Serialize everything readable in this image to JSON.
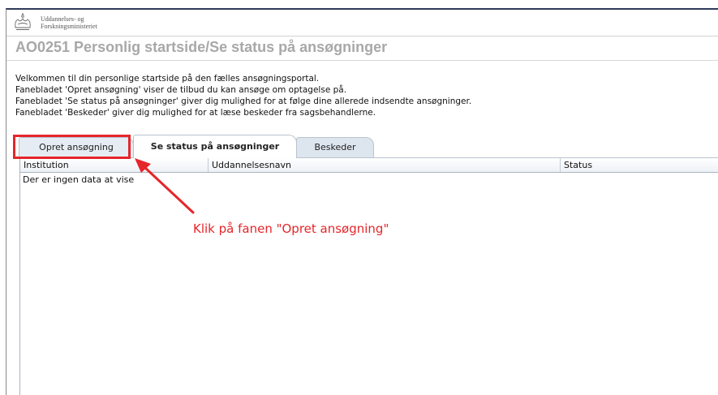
{
  "header": {
    "org_line1": "Uddannelses- og",
    "org_line2": "Forskningsministeriet",
    "title": "AO0251 Personlig startside/Se status på ansøgninger"
  },
  "intro": [
    "Velkommen til din personlige startside på den fælles ansøgningsportal.",
    "Fanebladet 'Opret ansøgning' viser de tilbud du kan ansøge om optagelse på.",
    "Fanebladet 'Se status på ansøgninger' giver dig mulighed for at følge dine allerede indsendte ansøgninger.",
    "Fanebladet 'Beskeder' giver dig mulighed for at læse beskeder fra sagsbehandlerne."
  ],
  "tabs": [
    {
      "label": "Opret ansøgning",
      "active": false
    },
    {
      "label": "Se status på ansøgninger",
      "active": true
    },
    {
      "label": "Beskeder",
      "active": false
    }
  ],
  "table": {
    "columns": [
      "Institution",
      "Uddannelsesnavn",
      "Status"
    ],
    "empty_text": "Der er ingen data at vise"
  },
  "annotation": {
    "text": "Klik på fanen \"Opret ansøgning\"",
    "color": "#e5262a"
  },
  "icons": {
    "logo": "crown-logo-icon"
  }
}
